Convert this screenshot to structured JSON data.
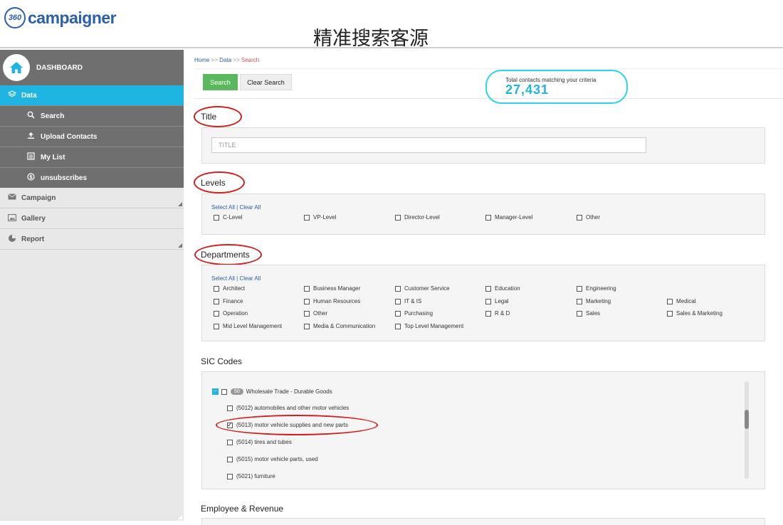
{
  "app": {
    "logo_mark": "360",
    "logo_text": "campaigner",
    "banner_title": "精准搜索客源"
  },
  "sidebar": {
    "dashboard": "DASHBOARD",
    "data": "Data",
    "sub_items": [
      {
        "label": "Search",
        "icon": "search-icon"
      },
      {
        "label": "Upload Contacts",
        "icon": "upload-icon"
      },
      {
        "label": "My List",
        "icon": "list-icon"
      },
      {
        "label": "unsubscribes",
        "icon": "dollar-icon"
      }
    ],
    "main_items": [
      {
        "label": "Campaign",
        "icon": "envelope-icon"
      },
      {
        "label": "Gallery",
        "icon": "image-icon"
      },
      {
        "label": "Report",
        "icon": "pie-chart-icon"
      }
    ]
  },
  "breadcrumb": {
    "home": "Home",
    "sep": ">>",
    "data": "Data",
    "current": "Search"
  },
  "toolbar": {
    "search_label": "Search",
    "clear_label": "Clear Search"
  },
  "total": {
    "label": "Total contacts matching your criteria",
    "value": "27,431"
  },
  "title_section": {
    "heading": "Title",
    "placeholder": "TITLE"
  },
  "levels": {
    "heading": "Levels",
    "select_all": "Select All",
    "divider": "|",
    "clear_all": "Clear All",
    "options": [
      "C-Level",
      "VP-Level",
      "Director-Level",
      "Manager-Level",
      "Other"
    ]
  },
  "departments": {
    "heading": "Departments",
    "select_all": "Select All",
    "divider": "|",
    "clear_all": "Clear All",
    "rows": [
      [
        "Architect",
        "Business Manager",
        "Customer Service",
        "Education",
        "Engineering",
        ""
      ],
      [
        "Finance",
        "Human Resources",
        "IT & IS",
        "Legal",
        "Marketing",
        "Medical"
      ],
      [
        "Operation",
        "Other",
        "Purchasing",
        "R & D",
        "Sales",
        "Sales & Marketing"
      ],
      [
        "Mid Level Management",
        "Media & Communication",
        "Top Level Management",
        "",
        "",
        ""
      ]
    ]
  },
  "sic": {
    "heading": "SIC Codes",
    "group_code": "50",
    "group_label": "Wholesale Trade - Durable Goods",
    "items": [
      {
        "label": "(5012) automobiles and other motor vehicles",
        "checked": false
      },
      {
        "label": "(5013) motor vehicle supplies and new parts",
        "checked": true
      },
      {
        "label": "(5014) tires and tubes",
        "checked": false
      },
      {
        "label": "(5015) motor vehicle parts, used",
        "checked": false
      },
      {
        "label": "(5021) furniture",
        "checked": false
      }
    ]
  },
  "employee_revenue": {
    "heading": "Employee & Revenue"
  },
  "colors": {
    "accent": "#1fb5e3",
    "sidebar_dark": "#6f6f6f",
    "search_button": "#5cb85c",
    "highlight_oval": "#cc2222",
    "total_box_border": "#29d3e8"
  }
}
